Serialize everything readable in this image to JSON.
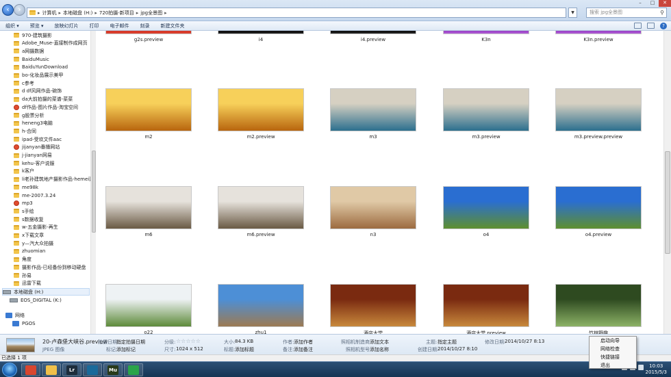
{
  "address_bar": {
    "breadcrumbs": [
      "计算机",
      "本地磁盘 (H:)",
      "720拍摄-新项目",
      "jpg全景图"
    ],
    "search_placeholder": "搜索 jpg全景图"
  },
  "toolbar": {
    "items": [
      "组织 ▾",
      "预览 ▾",
      "放映幻灯片",
      "打印",
      "电子邮件",
      "刻录",
      "新建文件夹"
    ]
  },
  "nav_pane": {
    "items": [
      {
        "label": "970-建筑摄影",
        "icon": "folder-icon"
      },
      {
        "label": "Adobe_Muse-直接制作成网页",
        "icon": "folder-icon"
      },
      {
        "label": "a网摄数据",
        "icon": "folder-icon"
      },
      {
        "label": "BaiduMusic",
        "icon": "folder-icon"
      },
      {
        "label": "BaiduYunDownload",
        "icon": "folder-icon"
      },
      {
        "label": "bo-化妆品展示美甲",
        "icon": "folder-icon"
      },
      {
        "label": "c参考",
        "icon": "folder-icon"
      },
      {
        "label": "d df风网作品-碗饰",
        "icon": "folder-icon"
      },
      {
        "label": "da大前拍摄的菜谱-菜菜",
        "icon": "folder-icon"
      },
      {
        "label": "df作品-图片作品-淘宝空间",
        "icon": "app-icon"
      },
      {
        "label": "g股票分析",
        "icon": "folder-icon"
      },
      {
        "label": "heneng3电脑",
        "icon": "folder-icon"
      },
      {
        "label": "h-合同",
        "icon": "folder-icon"
      },
      {
        "label": "ipad-受欢文件aac",
        "icon": "folder-icon"
      },
      {
        "label": "jijanyan番播网站",
        "icon": "app-icon"
      },
      {
        "label": "j-jianyan网易",
        "icon": "folder-icon"
      },
      {
        "label": "kehu-客户说服",
        "icon": "folder-icon"
      },
      {
        "label": "k客户",
        "icon": "folder-icon"
      },
      {
        "label": "li老孙建筑地产摄影作品-hemei建筑系",
        "icon": "folder-icon"
      },
      {
        "label": "me98k",
        "icon": "folder-icon"
      },
      {
        "label": "me-2007.3.24",
        "icon": "folder-icon"
      },
      {
        "label": "mp3",
        "icon": "app-icon"
      },
      {
        "label": "s手绘",
        "icon": "folder-icon"
      },
      {
        "label": "s数据收复",
        "icon": "folder-icon"
      },
      {
        "label": "w-五金摄影-再生",
        "icon": "folder-icon"
      },
      {
        "label": "x下载文章",
        "icon": "folder-icon"
      },
      {
        "label": "y—汽大众拍摄",
        "icon": "folder-icon"
      },
      {
        "label": "zhuomian",
        "icon": "folder-icon"
      },
      {
        "label": "角度",
        "icon": "folder-icon"
      },
      {
        "label": "摄影作品-已经备份到移动硬盘",
        "icon": "folder-icon"
      },
      {
        "label": "孙易",
        "icon": "folder-icon"
      },
      {
        "label": "迅雷下载",
        "icon": "folder-icon"
      },
      {
        "label": "本地磁盘 (H:)",
        "icon": "drive-icon"
      },
      {
        "label": "EOS_DIGITAL (K:)",
        "icon": "drive-icon"
      },
      {
        "label": "网络",
        "icon": "network-icon"
      },
      {
        "label": "PGOS",
        "icon": "network-icon"
      }
    ]
  },
  "files": [
    {
      "name": "g2s.preview",
      "colors": [
        "#d43a2a",
        "#e0412f"
      ]
    },
    {
      "name": "i4",
      "colors": [
        "#111111",
        "#222222"
      ]
    },
    {
      "name": "i4.preview",
      "colors": [
        "#111111",
        "#2a2a2a"
      ]
    },
    {
      "name": "K3n",
      "colors": [
        "#9c47c8",
        "#b65fd9"
      ]
    },
    {
      "name": "K3n.preview",
      "colors": [
        "#9c47c8",
        "#b65fd9"
      ]
    },
    {
      "name": "m2",
      "colors": [
        "#f7d05a",
        "#b8650e"
      ]
    },
    {
      "name": "m2.preview",
      "colors": [
        "#f7d05a",
        "#b8650e"
      ]
    },
    {
      "name": "m3",
      "colors": [
        "#d6d0c2",
        "#2c6f8e"
      ]
    },
    {
      "name": "m3.preview",
      "colors": [
        "#d6d0c2",
        "#2c6f8e"
      ]
    },
    {
      "name": "m3.preview.preview",
      "colors": [
        "#d6d0c2",
        "#2c6f8e"
      ]
    },
    {
      "name": "m6",
      "colors": [
        "#e6e2dc",
        "#6a5a44"
      ]
    },
    {
      "name": "m6.preview",
      "colors": [
        "#e6e2dc",
        "#6a5a44"
      ]
    },
    {
      "name": "n3",
      "colors": [
        "#e0c9a6",
        "#9c6b40"
      ]
    },
    {
      "name": "o4",
      "colors": [
        "#2a6ed1",
        "#5e8f2f"
      ]
    },
    {
      "name": "o4.preview",
      "colors": [
        "#2a6ed1",
        "#5e8f2f"
      ]
    },
    {
      "name": "o22",
      "colors": [
        "#eef2f4",
        "#5d8a3a"
      ]
    },
    {
      "name": "zhu1",
      "colors": [
        "#4d8fd6",
        "#9c7a52"
      ]
    },
    {
      "name": "酒店大堂",
      "colors": [
        "#7a2a10",
        "#c8893c"
      ]
    },
    {
      "name": "酒店大堂.preview",
      "colors": [
        "#7a2a10",
        "#c8893c"
      ]
    },
    {
      "name": "竹林野趣",
      "colors": [
        "#2e4a20",
        "#8cb266"
      ]
    }
  ],
  "details": {
    "name": "20-卢森堡大峡谷.preview",
    "type": "JPEG 图像",
    "fields": [
      {
        "label": "拍摄日期:",
        "value": "指定拍摄日期"
      },
      {
        "label": "标记:",
        "value": "添加标记"
      },
      {
        "label": "分级:",
        "value": "☆☆☆☆☆"
      },
      {
        "label": "尺寸:",
        "value": "1024 x 512"
      },
      {
        "label": "大小:",
        "value": "84.3 KB"
      },
      {
        "label": "标题:",
        "value": "添加标题"
      },
      {
        "label": "作者:",
        "value": "添加作者"
      },
      {
        "label": "备注:",
        "value": "添加备注"
      },
      {
        "label": "照相机制造商:",
        "value": "添加文本"
      },
      {
        "label": "照相机型号:",
        "value": "添加名称"
      },
      {
        "label": "主题:",
        "value": "指定主题"
      },
      {
        "label": "创建日期:",
        "value": "2014/10/27 8:10"
      },
      {
        "label": "修改日期:",
        "value": "2014/10/27 8:13"
      }
    ]
  },
  "status_bar": {
    "text": "已选择 1 项"
  },
  "context_menu": {
    "items": [
      "启动向导",
      "网络检查",
      "快捷链接",
      "退出"
    ]
  },
  "taskbar": {
    "apps": [
      {
        "name": "chrome",
        "label": "",
        "color": "#d8462f"
      },
      {
        "name": "explorer",
        "label": "",
        "color": "#f0c04a"
      },
      {
        "name": "lightroom",
        "label": "Lr",
        "color": "#1d2d3c"
      },
      {
        "name": "photoshop",
        "label": "",
        "color": "#1a6a9a"
      },
      {
        "name": "muse",
        "label": "Mu",
        "color": "#283a1a"
      },
      {
        "name": "updater",
        "label": "",
        "color": "#2aa44a"
      }
    ],
    "clock_time": "10:03",
    "clock_date": "2015/5/3"
  }
}
